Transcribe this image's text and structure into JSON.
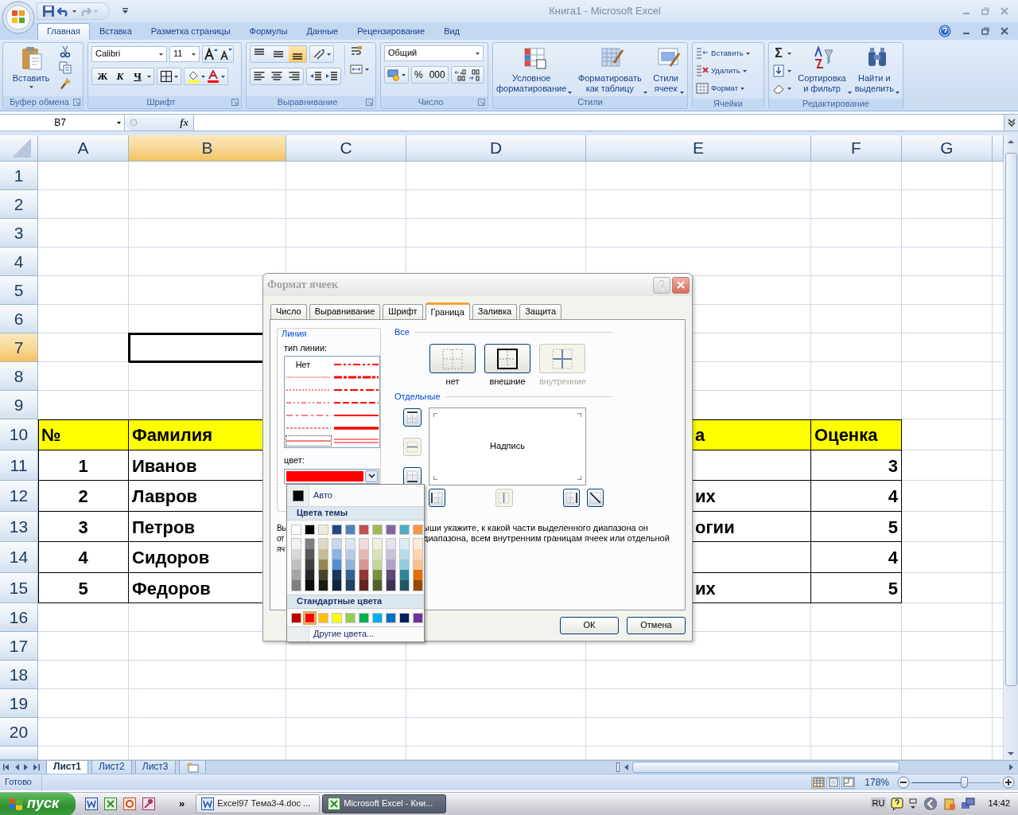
{
  "window": {
    "title": "Книга1 - Microsoft Excel"
  },
  "ribbon": {
    "tabs": [
      {
        "label": "Главная",
        "selected": true
      },
      {
        "label": "Вставка",
        "selected": false
      },
      {
        "label": "Разметка страницы",
        "selected": false
      },
      {
        "label": "Формулы",
        "selected": false
      },
      {
        "label": "Данные",
        "selected": false
      },
      {
        "label": "Рецензирование",
        "selected": false
      },
      {
        "label": "Вид",
        "selected": false
      }
    ],
    "groups": [
      {
        "kind": "clipboard",
        "label": "Буфер обмена",
        "paste": "Вставить"
      },
      {
        "kind": "font",
        "label": "Шрифт",
        "font": "Calibri",
        "size": "11",
        "bold": "Ж",
        "italic": "К",
        "underline": "Ч"
      },
      {
        "kind": "alignment",
        "label": "Выравнивание",
        "vertical": [
          {
            "kind": "top",
            "selected": false
          },
          {
            "kind": "middle",
            "selected": false
          },
          {
            "kind": "bottom",
            "selected": true
          }
        ]
      },
      {
        "kind": "number",
        "label": "Число",
        "format": "Общий",
        "percent": "%",
        "thousands": "000"
      },
      {
        "kind": "styles",
        "label": "Стили",
        "buttons": [
          "Условное\nформатирование",
          "Форматировать\nкак таблицу",
          "Стили\nячеек"
        ]
      },
      {
        "kind": "cells",
        "label": "Ячейки",
        "buttons": [
          "Вставить",
          "Удалить",
          "Формат"
        ]
      },
      {
        "kind": "editing",
        "label": "Редактирование",
        "sum": "Σ",
        "buttons": [
          "Сортировка\nи фильтр",
          "Найти и\nвыделить"
        ]
      }
    ]
  },
  "formula_bar": {
    "name_box": "B7",
    "function_label": "fx"
  },
  "sheet": {
    "columns": [
      {
        "label": "A",
        "selected": false
      },
      {
        "label": "B",
        "selected": true
      },
      {
        "label": "C",
        "selected": false
      },
      {
        "label": "D",
        "selected": false
      },
      {
        "label": "E",
        "selected": false
      },
      {
        "label": "F",
        "selected": false
      },
      {
        "label": "G",
        "selected": false
      }
    ],
    "rows": [
      {
        "label": "1",
        "selected": false
      },
      {
        "label": "2",
        "selected": false
      },
      {
        "label": "3",
        "selected": false
      },
      {
        "label": "4",
        "selected": false
      },
      {
        "label": "5",
        "selected": false
      },
      {
        "label": "6",
        "selected": false
      },
      {
        "label": "7",
        "selected": true
      },
      {
        "label": "8",
        "selected": false
      },
      {
        "label": "9",
        "selected": false
      },
      {
        "label": "10",
        "selected": false,
        "kind": "header",
        "cells": [
          "№",
          "Фамилия",
          null,
          null,
          "а",
          "Оценка"
        ]
      },
      {
        "label": "11",
        "selected": false,
        "kind": "data",
        "cells": [
          "1",
          "Иванов",
          null,
          null,
          null,
          "3"
        ]
      },
      {
        "label": "12",
        "selected": false,
        "kind": "data",
        "cells": [
          "2",
          "Лавров",
          null,
          null,
          "их",
          "4"
        ]
      },
      {
        "label": "13",
        "selected": false,
        "kind": "data",
        "cells": [
          "3",
          "Петров",
          null,
          null,
          "огии",
          "5"
        ]
      },
      {
        "label": "14",
        "selected": false,
        "kind": "data",
        "cells": [
          "4",
          "Сидоров",
          null,
          null,
          null,
          "4"
        ]
      },
      {
        "label": "15",
        "selected": false,
        "kind": "data",
        "cells": [
          "5",
          "Федоров",
          null,
          null,
          "их",
          "5"
        ]
      },
      {
        "label": "16",
        "selected": false
      },
      {
        "label": "17",
        "selected": false
      },
      {
        "label": "18",
        "selected": false
      },
      {
        "label": "19",
        "selected": false
      },
      {
        "label": "20",
        "selected": false
      }
    ]
  },
  "dialog": {
    "title": "Формат ячеек",
    "tabs": [
      {
        "label": "Число",
        "selected": false
      },
      {
        "label": "Выравнивание",
        "selected": false
      },
      {
        "label": "Шрифт",
        "selected": false
      },
      {
        "label": "Граница",
        "selected": true
      },
      {
        "label": "Заливка",
        "selected": false
      },
      {
        "label": "Защита",
        "selected": false
      }
    ],
    "line": {
      "label": "Линия",
      "type_label": "тип линии:",
      "color_label": "цвет:",
      "color": "#ff0000",
      "styles": [
        {
          "kind": "none",
          "label": "Нет",
          "selected": false
        },
        {
          "kind": "hair",
          "selected": false
        },
        {
          "kind": "dotted",
          "selected": false
        },
        {
          "kind": "dash-dot-dot",
          "selected": false
        },
        {
          "kind": "dash-dot",
          "selected": false
        },
        {
          "kind": "dashed",
          "selected": false
        },
        {
          "kind": "thin",
          "selected": true
        },
        {
          "kind": "medium-dash-dot-dot",
          "selected": false
        },
        {
          "kind": "slant-dash-dot",
          "selected": false
        },
        {
          "kind": "medium-dash-dot",
          "selected": false
        },
        {
          "kind": "medium-dashed",
          "selected": false
        },
        {
          "kind": "medium",
          "selected": false
        },
        {
          "kind": "thick",
          "selected": false
        },
        {
          "kind": "double",
          "selected": false
        }
      ]
    },
    "presets": {
      "label": "Все",
      "items": [
        {
          "kind": "none",
          "label": "нет",
          "disabled": false
        },
        {
          "kind": "outline",
          "label": "внешние",
          "disabled": false
        },
        {
          "kind": "inside",
          "label": "внутренние",
          "disabled": true
        }
      ]
    },
    "border": {
      "label": "Отдельные",
      "preview": "Надпись",
      "side_buttons": [
        {
          "kind": "top",
          "disabled": false
        },
        {
          "kind": "middle",
          "disabled": true
        },
        {
          "kind": "bottom",
          "disabled": false
        }
      ],
      "bottom_buttons": [
        {
          "kind": "left",
          "disabled": false
        },
        {
          "kind": "center",
          "disabled": true
        },
        {
          "kind": "right",
          "disabled": false
        },
        {
          "kind": "diagonal",
          "disabled": false
        }
      ]
    },
    "description": {
      "left": [
        "Вы",
        "от",
        "яч"
      ],
      "right": [
        "ыши укажите, к какой части выделенного диапазона он",
        "диапазона, всем внутренним границам ячеек или отдельной"
      ]
    },
    "buttons": [
      "ОК",
      "Отмена"
    ]
  },
  "color_menu": {
    "auto": "Авто",
    "theme_label": "Цвета темы",
    "theme_colors": [
      {
        "color": "#ffffff",
        "shades": [
          {
            "color": "#f2f2f2"
          },
          {
            "color": "#d8d8d8"
          },
          {
            "color": "#bfbfbf"
          },
          {
            "color": "#a5a5a5"
          },
          {
            "color": "#7f7f7f"
          }
        ]
      },
      {
        "color": "#000000",
        "shades": [
          {
            "color": "#7f7f7f"
          },
          {
            "color": "#595959"
          },
          {
            "color": "#3f3f3f"
          },
          {
            "color": "#262626"
          },
          {
            "color": "#0c0c0c"
          }
        ]
      },
      {
        "color": "#eeece1",
        "shades": [
          {
            "color": "#ddd9c3"
          },
          {
            "color": "#c4bd97"
          },
          {
            "color": "#938953"
          },
          {
            "color": "#494429"
          },
          {
            "color": "#1d1b10"
          }
        ]
      },
      {
        "color": "#1f497d",
        "shades": [
          {
            "color": "#c6d9f0"
          },
          {
            "color": "#8db3e2"
          },
          {
            "color": "#548dd4"
          },
          {
            "color": "#17365d"
          },
          {
            "color": "#0f243e"
          }
        ]
      },
      {
        "color": "#4f81bd",
        "shades": [
          {
            "color": "#dbe5f1"
          },
          {
            "color": "#b8cce4"
          },
          {
            "color": "#95b3d7"
          },
          {
            "color": "#366092"
          },
          {
            "color": "#244061"
          }
        ]
      },
      {
        "color": "#c0504d",
        "shades": [
          {
            "color": "#f2dcdb"
          },
          {
            "color": "#e5b9b7"
          },
          {
            "color": "#d99694"
          },
          {
            "color": "#953734"
          },
          {
            "color": "#632423"
          }
        ]
      },
      {
        "color": "#9bbb59",
        "shades": [
          {
            "color": "#ebf1dd"
          },
          {
            "color": "#d7e3bc"
          },
          {
            "color": "#c3d69b"
          },
          {
            "color": "#76923c"
          },
          {
            "color": "#4f6128"
          }
        ]
      },
      {
        "color": "#8064a2",
        "shades": [
          {
            "color": "#e5e0ec"
          },
          {
            "color": "#ccc1d9"
          },
          {
            "color": "#b2a2c7"
          },
          {
            "color": "#5f497a"
          },
          {
            "color": "#3f3151"
          }
        ]
      },
      {
        "color": "#4bacc6",
        "shades": [
          {
            "color": "#dbeef3"
          },
          {
            "color": "#b7dde8"
          },
          {
            "color": "#92cddc"
          },
          {
            "color": "#31859b"
          },
          {
            "color": "#205867"
          }
        ]
      },
      {
        "color": "#f79646",
        "shades": [
          {
            "color": "#fdeada"
          },
          {
            "color": "#fbd5b5"
          },
          {
            "color": "#fac08f"
          },
          {
            "color": "#e36c09"
          },
          {
            "color": "#974806"
          }
        ]
      }
    ],
    "standard_label": "Стандартные цвета",
    "standard_colors": [
      {
        "color": "#c00000",
        "selected": false
      },
      {
        "color": "#ff0000",
        "selected": true
      },
      {
        "color": "#ffc000",
        "selected": false
      },
      {
        "color": "#ffff00",
        "selected": false
      },
      {
        "color": "#92d050",
        "selected": false
      },
      {
        "color": "#00b050",
        "selected": false
      },
      {
        "color": "#00b0f0",
        "selected": false
      },
      {
        "color": "#0070c0",
        "selected": false
      },
      {
        "color": "#002060",
        "selected": false
      },
      {
        "color": "#7030a0",
        "selected": false
      }
    ],
    "more": "Другие цвета..."
  },
  "sheet_tabs": [
    {
      "label": "Лист1",
      "selected": true
    },
    {
      "label": "Лист2",
      "selected": false
    },
    {
      "label": "Лист3",
      "selected": false
    }
  ],
  "status_bar": {
    "text": "Готово",
    "views": [
      {
        "kind": "normal",
        "selected": true
      },
      {
        "kind": "layout",
        "selected": false
      },
      {
        "kind": "page-break",
        "selected": false
      }
    ],
    "zoom": {
      "label": "178%",
      "level": 0.59
    }
  },
  "taskbar": {
    "start": "пуск",
    "overflow": "»",
    "tasks": [
      {
        "label": "Excel97 Тема3-4.doc ...",
        "kind": "word",
        "selected": false
      },
      {
        "label": "Microsoft Excel - Кни...",
        "kind": "excel",
        "selected": true
      }
    ],
    "language": "RU",
    "time": "14:42"
  }
}
